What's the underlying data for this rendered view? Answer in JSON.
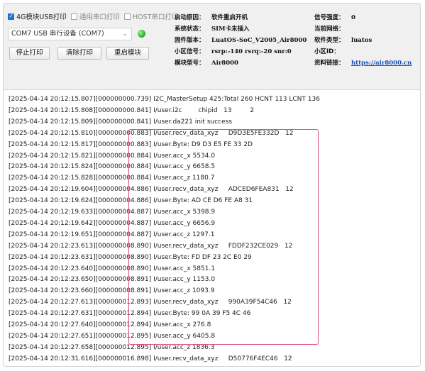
{
  "options": {
    "usb4g": {
      "label": "4G模块USB打印",
      "checked": true
    },
    "serial": {
      "label": "通用串口打印",
      "checked": false
    },
    "host": {
      "label": "HOST串口打印",
      "checked": false
    }
  },
  "port": {
    "value": "COM7 USB 串行设备 (COM7)"
  },
  "buttons": {
    "stop": "停止打印",
    "clear": "清除打印",
    "restart": "重启模块"
  },
  "info_left": [
    {
      "key": "启动原因：",
      "value": "软件重启开机"
    },
    {
      "key": "系统状态：",
      "value": "SIM卡未插入"
    },
    {
      "key": "固件版本：",
      "value": "LuatOS-SoC_V2005_Air8000"
    },
    {
      "key": "小区信号：",
      "value": "rsrp:-140 rsrq:-20 snr:0"
    },
    {
      "key": "模块型号：",
      "value": "Air8000"
    }
  ],
  "info_right": [
    {
      "key": "信号强度：",
      "value": "0"
    },
    {
      "key": "当前网络：",
      "value": ""
    },
    {
      "key": "软件类型：",
      "value": "luatos"
    },
    {
      "key": "小区ID：",
      "value": ""
    },
    {
      "key": "资料链接：",
      "value": "https://air8000.cn"
    }
  ],
  "log_lines": [
    "[2025-04-14 20:12:15.807][000000000.739] I2C_MasterSetup 425:Total 260 HCNT 113 LCNT 136",
    "[2025-04-14 20:12:15.808][000000000.841] I/user.i2c        chipid   13         2",
    "[2025-04-14 20:12:15.809][000000000.841] I/user.da221 init success",
    "[2025-04-14 20:12:15.810][000000000.883] I/user.recv_data_xyz     D9D3E5FE332D   12",
    "[2025-04-14 20:12:15.817][000000000.883] I/user.Byte: D9 D3 E5 FE 33 2D",
    "[2025-04-14 20:12:15.821][000000000.884] I/user.acc_x 5534.0",
    "[2025-04-14 20:12:15.824][000000000.884] I/user.acc_y 6658.5",
    "[2025-04-14 20:12:15.828][000000000.884] I/user.acc_z 1180.7",
    "[2025-04-14 20:12:19.604][000000004.886] I/user.recv_data_xyz     ADCED6FEA831   12",
    "[2025-04-14 20:12:19.624][000000004.886] I/user.Byte: AD CE D6 FE A8 31",
    "[2025-04-14 20:12:19.633][000000004.887] I/user.acc_x 5398.9",
    "[2025-04-14 20:12:19.642][000000004.887] I/user.acc_y 6656.9",
    "[2025-04-14 20:12:19.651][000000004.887] I/user.acc_z 1297.1",
    "[2025-04-14 20:12:23.613][000000008.890] I/user.recv_data_xyz     FDDF232CE029   12",
    "[2025-04-14 20:12:23.631][000000008.890] I/user.Byte: FD DF 23 2C E0 29",
    "[2025-04-14 20:12:23.640][000000008.890] I/user.acc_x 5851.1",
    "[2025-04-14 20:12:23.650][000000008.891] I/user.acc_y 1153.0",
    "[2025-04-14 20:12:23.660][000000008.891] I/user.acc_z 1093.9",
    "[2025-04-14 20:12:27.613][000000012.893] I/user.recv_data_xyz     990A39F54C46   12",
    "[2025-04-14 20:12:27.631][000000012.894] I/user.Byte: 99 0A 39 F5 4C 46",
    "[2025-04-14 20:12:27.640][000000012.894] I/user.acc_x 276.8",
    "[2025-04-14 20:12:27.651][000000012.895] I/user.acc_y 6405.8",
    "[2025-04-14 20:12:27.658][000000012.895] I/user.acc_z 1836.3",
    "[2025-04-14 20:12:31.616][000000016.898] I/user.recv_data_xyz     D50776F4EC46   12"
  ],
  "colors": {
    "highlight": "#e0507a",
    "led": "#2db52a",
    "checkbox": "#1e6fd6",
    "link": "#1a4fb8"
  }
}
